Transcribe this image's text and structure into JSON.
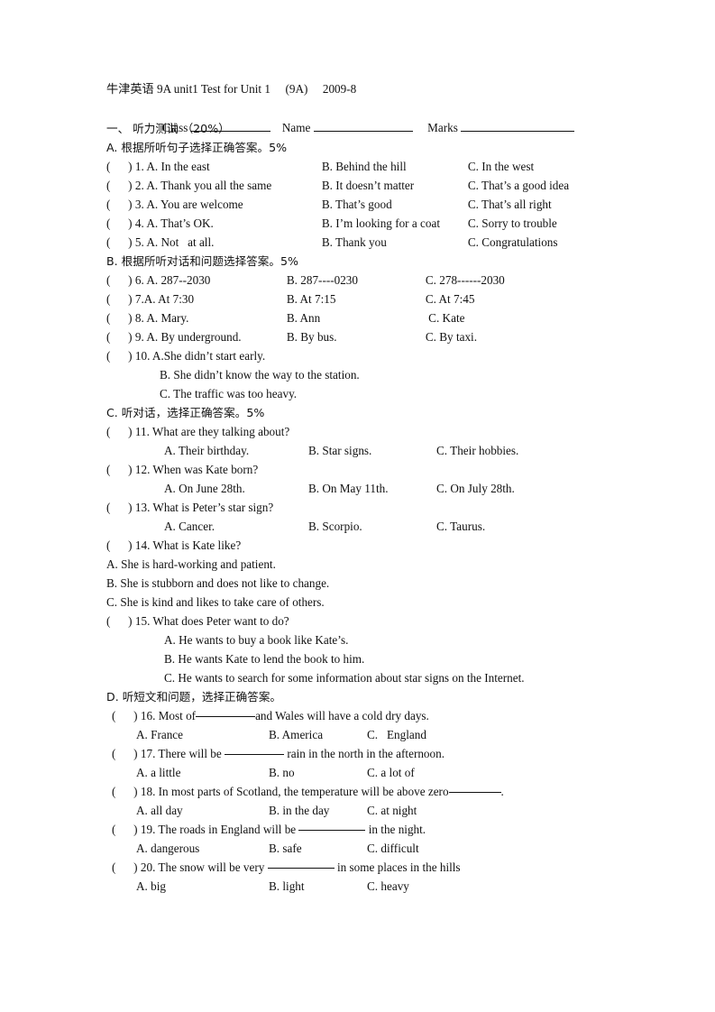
{
  "header": {
    "title": "牛津英语 9A unit1 Test for Unit 1     (9A)     2009-8",
    "field_class": "Class",
    "field_name": "Name",
    "field_marks": "Marks"
  },
  "part_one": {
    "heading": "一、 听力测试 （20%）",
    "sections": [
      {
        "label": "A.",
        "heading": "A. 根据所听句子选择正确答案。5%",
        "items": [
          {
            "mark": "(      )",
            "num": "1.",
            "a": "A. In the east",
            "b": "B. Behind the hill",
            "c": "C. In the west"
          },
          {
            "mark": "(      )",
            "num": "2.",
            "a": "A. Thank you all the same",
            "b": "B. It doesn’t matter",
            "c": "C. That’s a good idea"
          },
          {
            "mark": "(      )",
            "num": "3.",
            "a": "A. You are welcome",
            "b": "B. That’s good",
            "c": "C. That’s all right"
          },
          {
            "mark": "(      )",
            "num": "4.",
            "a": "A. That’s OK.",
            "b": "B. I’m looking for a coat",
            "c": "C. Sorry to trouble"
          },
          {
            "mark": "(      )",
            "num": "5.",
            "a": "A. Not   at all.",
            "b": "B. Thank you",
            "c": "C. Congratulations"
          }
        ]
      },
      {
        "label": "B.",
        "heading": "B. 根据所听对话和问题选择答案。5%",
        "items": [
          {
            "mark": "(      )",
            "num": "6.",
            "a": "A. 287--2030",
            "b": "B. 287----0230",
            "c": "C. 278------2030"
          },
          {
            "mark": "(      )",
            "num": "7.",
            "a": "A. At 7:30",
            "b": "B. At 7:15",
            "c": "C. At 7:45"
          },
          {
            "mark": "(      )",
            "num": "8.",
            "a": "A. Mary.",
            "b": "B. Ann",
            "c": " C. Kate"
          },
          {
            "mark": "(      )",
            "num": "9.",
            "a": "A. By underground.",
            "b": "B. By bus.",
            "c": "C. By taxi."
          }
        ],
        "item10": {
          "mark": "(      )",
          "stem": "10. A.She didn’t start early.",
          "b": "B. She didn’t know the way to the station.",
          "c": "C. The traffic was too heavy."
        }
      },
      {
        "label": "C.",
        "heading": "C. 听对话，选择正确答案。5%",
        "items": [
          {
            "mark": "(      )",
            "stem": "11. What are they talking about?",
            "a": "A. Their birthday.",
            "b": "B. Star signs.",
            "c": "C. Their hobbies."
          },
          {
            "mark": "(      )",
            "stem": "12. When was Kate born?",
            "a": "A. On June 28th.",
            "b": "B. On May 11th.",
            "c": "C. On July 28th."
          },
          {
            "mark": "(      )",
            "stem": "13. What is Peter’s star sign?",
            "a": "A. Cancer.",
            "b": "B. Scorpio.",
            "c": "C. Taurus."
          }
        ],
        "item14": {
          "mark": "(      )",
          "stem": "14. What is Kate like?",
          "a": "A. She is hard-working and patient.",
          "b": "B. She is stubborn and does not like to change.",
          "c": "C. She is kind and likes to take care of others."
        },
        "item15": {
          "mark": "(      )",
          "stem": "15. What does Peter want to do?",
          "a": "A. He wants to buy a book like Kate’s.",
          "b": "B. He wants Kate to lend the book to him.",
          "c": "C. He wants to search for some information about star signs on the Internet."
        }
      },
      {
        "label": "D.",
        "heading": "D. 听短文和问题，选择正确答案。",
        "items": [
          {
            "mark": "(      )",
            "stem_pre": "16. Most of",
            "stem_post": "and Wales will have a cold dry days.",
            "a": "A. France",
            "b": "B. America",
            "c": "C.   England"
          },
          {
            "mark": "(      )",
            "stem_pre": "17. There will be ",
            "stem_post": " rain in the north in the afternoon.",
            "a": "A. a little",
            "b": "B. no",
            "c": "C. a lot of"
          },
          {
            "mark": "(      )",
            "stem_pre": "18. In most parts of Scotland, the temperature will be above zero",
            "stem_post": ".",
            "a": "A. all day",
            "b": "B. in the day",
            "c": "C. at night"
          },
          {
            "mark": "(      )",
            "stem_pre": "19. The roads in England will be ",
            "stem_post": " in the night.",
            "a": "A. dangerous",
            "b": "B. safe",
            "c": "C. difficult"
          },
          {
            "mark": "(      )",
            "stem_pre": "20. The snow will be very ",
            "stem_post": " in some places in the hills",
            "a": "A. big",
            "b": "B. light",
            "c": "C. heavy"
          }
        ]
      }
    ]
  }
}
